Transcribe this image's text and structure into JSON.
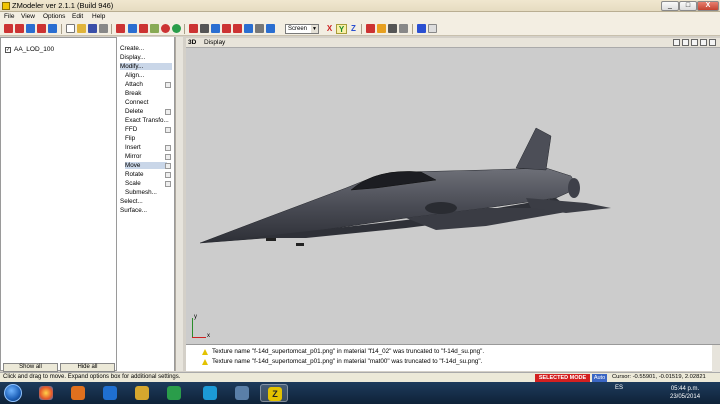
{
  "window": {
    "title": "ZModeler ver 2.1.1 (Build 946)",
    "min": "_",
    "max": "□",
    "close": "X"
  },
  "menu": {
    "file": "File",
    "view": "View",
    "options": "Options",
    "edit": "Edit",
    "help": "Help"
  },
  "toolbar": {
    "view_mode": "Screen",
    "axis_x": "X",
    "axis_y": "Y",
    "axis_z": "Z"
  },
  "scene_tree": {
    "item": "AA_LOD_100",
    "show_all": "Show all",
    "hide_all": "Hide all"
  },
  "commands": {
    "create": "Create...",
    "display": "Display...",
    "modify": "Modify...",
    "align": "Align...",
    "attach": "Attach",
    "break": "Break",
    "connect": "Connect",
    "delete": "Delete",
    "exact_transform": "Exact Transfo...",
    "ffd": "FFD",
    "flip": "Flip",
    "insert": "Insert",
    "mirror": "Mirror",
    "move": "Move",
    "rotate": "Rotate",
    "scale": "Scale",
    "submesh": "Submesh...",
    "select": "Select...",
    "surface": "Surface..."
  },
  "viewport": {
    "tag": "3D",
    "name": "Display",
    "axis_x": "x",
    "axis_y": "y"
  },
  "log": {
    "line1": "Texture name \"f-14d_supertomcat_p01.png\" in material \"f14_02\" was truncated to \"f-14d_su.png\".",
    "line2": "Texture name \"f-14d_supertomcat_p01.png\" in material \"mat00\" was truncated to \"f-14d_su.png\"."
  },
  "status": {
    "hint": "Click and drag to move. Expand options box for additional settings.",
    "mode": "SELECTED MODE",
    "auto": "Auto",
    "cursor": "Cursor: -0.55901, -0.01519, 2.02821"
  },
  "taskbar": {
    "lang": "ES",
    "time": "05:44 p.m.",
    "date": "23/05/2014",
    "active_app": "Z"
  },
  "colors": {
    "selected_mode": "#d32020",
    "auto": "#3a66c4",
    "viewport_bg": "#cccccc",
    "taskbar": "#1d3b5c"
  }
}
